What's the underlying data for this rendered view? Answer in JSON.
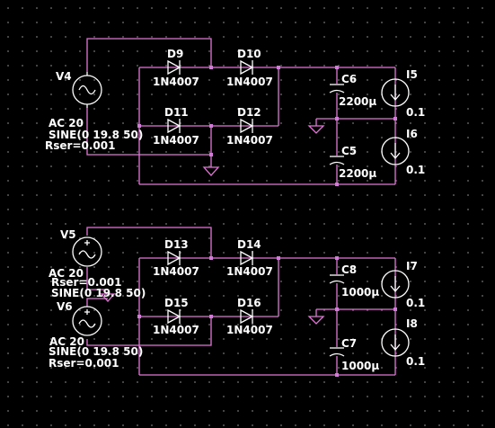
{
  "colors": {
    "background": "#000000",
    "wire": "#e277d8",
    "component": "#ffffff",
    "node": "#d17ad8",
    "grid_dot": "#5a5a5a"
  },
  "sources": [
    {
      "ref": "V4",
      "lines": [
        "AC 20",
        "SINE(0 19.8 50)",
        "Rser=0.001"
      ]
    },
    {
      "ref": "V5",
      "lines": [
        "AC 20",
        "Rser=0.001"
      ]
    },
    {
      "ref": "V6",
      "lines": [
        "AC 20",
        "SINE(0 19.8 50)",
        "Rser=0.001"
      ]
    }
  ],
  "overlap_text": "SINE(0 19.8 50)",
  "diodes": [
    {
      "ref": "D9",
      "model": "1N4007"
    },
    {
      "ref": "D10",
      "model": "1N4007"
    },
    {
      "ref": "D11",
      "model": "1N4007"
    },
    {
      "ref": "D12",
      "model": "1N4007"
    },
    {
      "ref": "D13",
      "model": "1N4007"
    },
    {
      "ref": "D14",
      "model": "1N4007"
    },
    {
      "ref": "D15",
      "model": "1N4007"
    },
    {
      "ref": "D16",
      "model": "1N4007"
    }
  ],
  "capacitors": [
    {
      "ref": "C6",
      "value": "2200µ"
    },
    {
      "ref": "C5",
      "value": "2200µ"
    },
    {
      "ref": "C8",
      "value": "1000µ"
    },
    {
      "ref": "C7",
      "value": "1000µ"
    }
  ],
  "current_sources": [
    {
      "ref": "I5",
      "value": "0.1"
    },
    {
      "ref": "I6",
      "value": "0.1"
    },
    {
      "ref": "I7",
      "value": "0.1"
    },
    {
      "ref": "I8",
      "value": "0.1"
    }
  ]
}
